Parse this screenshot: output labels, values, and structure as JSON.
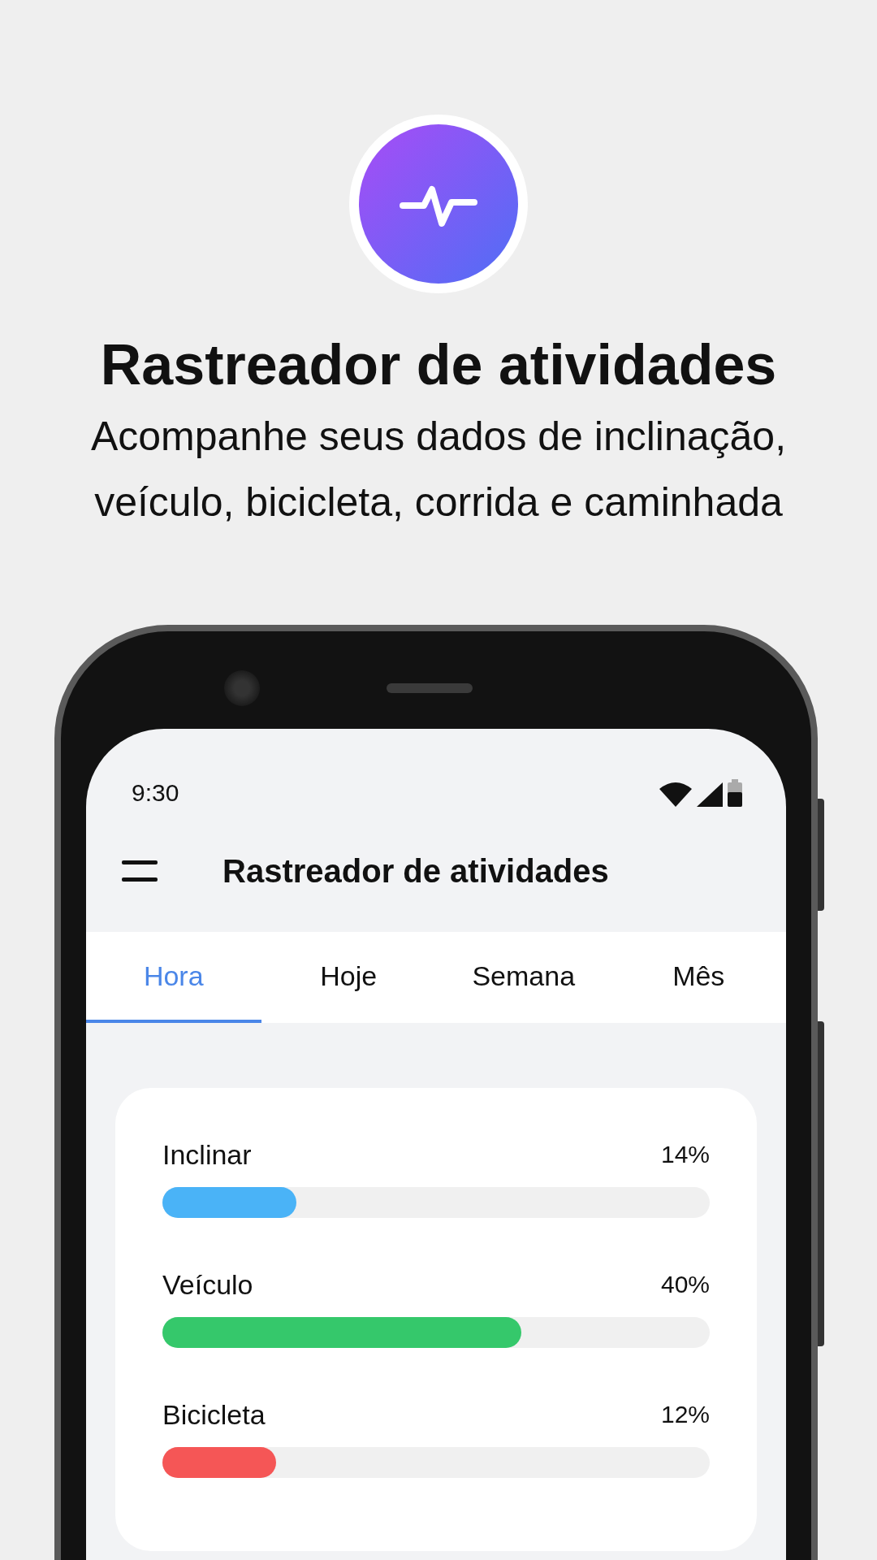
{
  "promo": {
    "title": "Rastreador de atividades",
    "subtitle": "Acompanhe seus dados de inclinação,\nveículo, bicicleta, corrida e caminhada"
  },
  "status_bar": {
    "time": "9:30"
  },
  "app_bar": {
    "title": "Rastreador de atividades"
  },
  "tabs": [
    {
      "label": "Hora",
      "selected": true
    },
    {
      "label": "Hoje",
      "selected": false
    },
    {
      "label": "Semana",
      "selected": false
    },
    {
      "label": "Mês",
      "selected": false
    }
  ],
  "activities": [
    {
      "name": "Inclinar",
      "reading": "14%",
      "level": 0.245,
      "color": "#4ab3f7"
    },
    {
      "name": "Veículo",
      "reading": "40%",
      "level": 0.656,
      "color": "#35c86b"
    },
    {
      "name": "Bicicleta",
      "reading": "12%",
      "level": 0.207,
      "color": "#f55656"
    }
  ]
}
